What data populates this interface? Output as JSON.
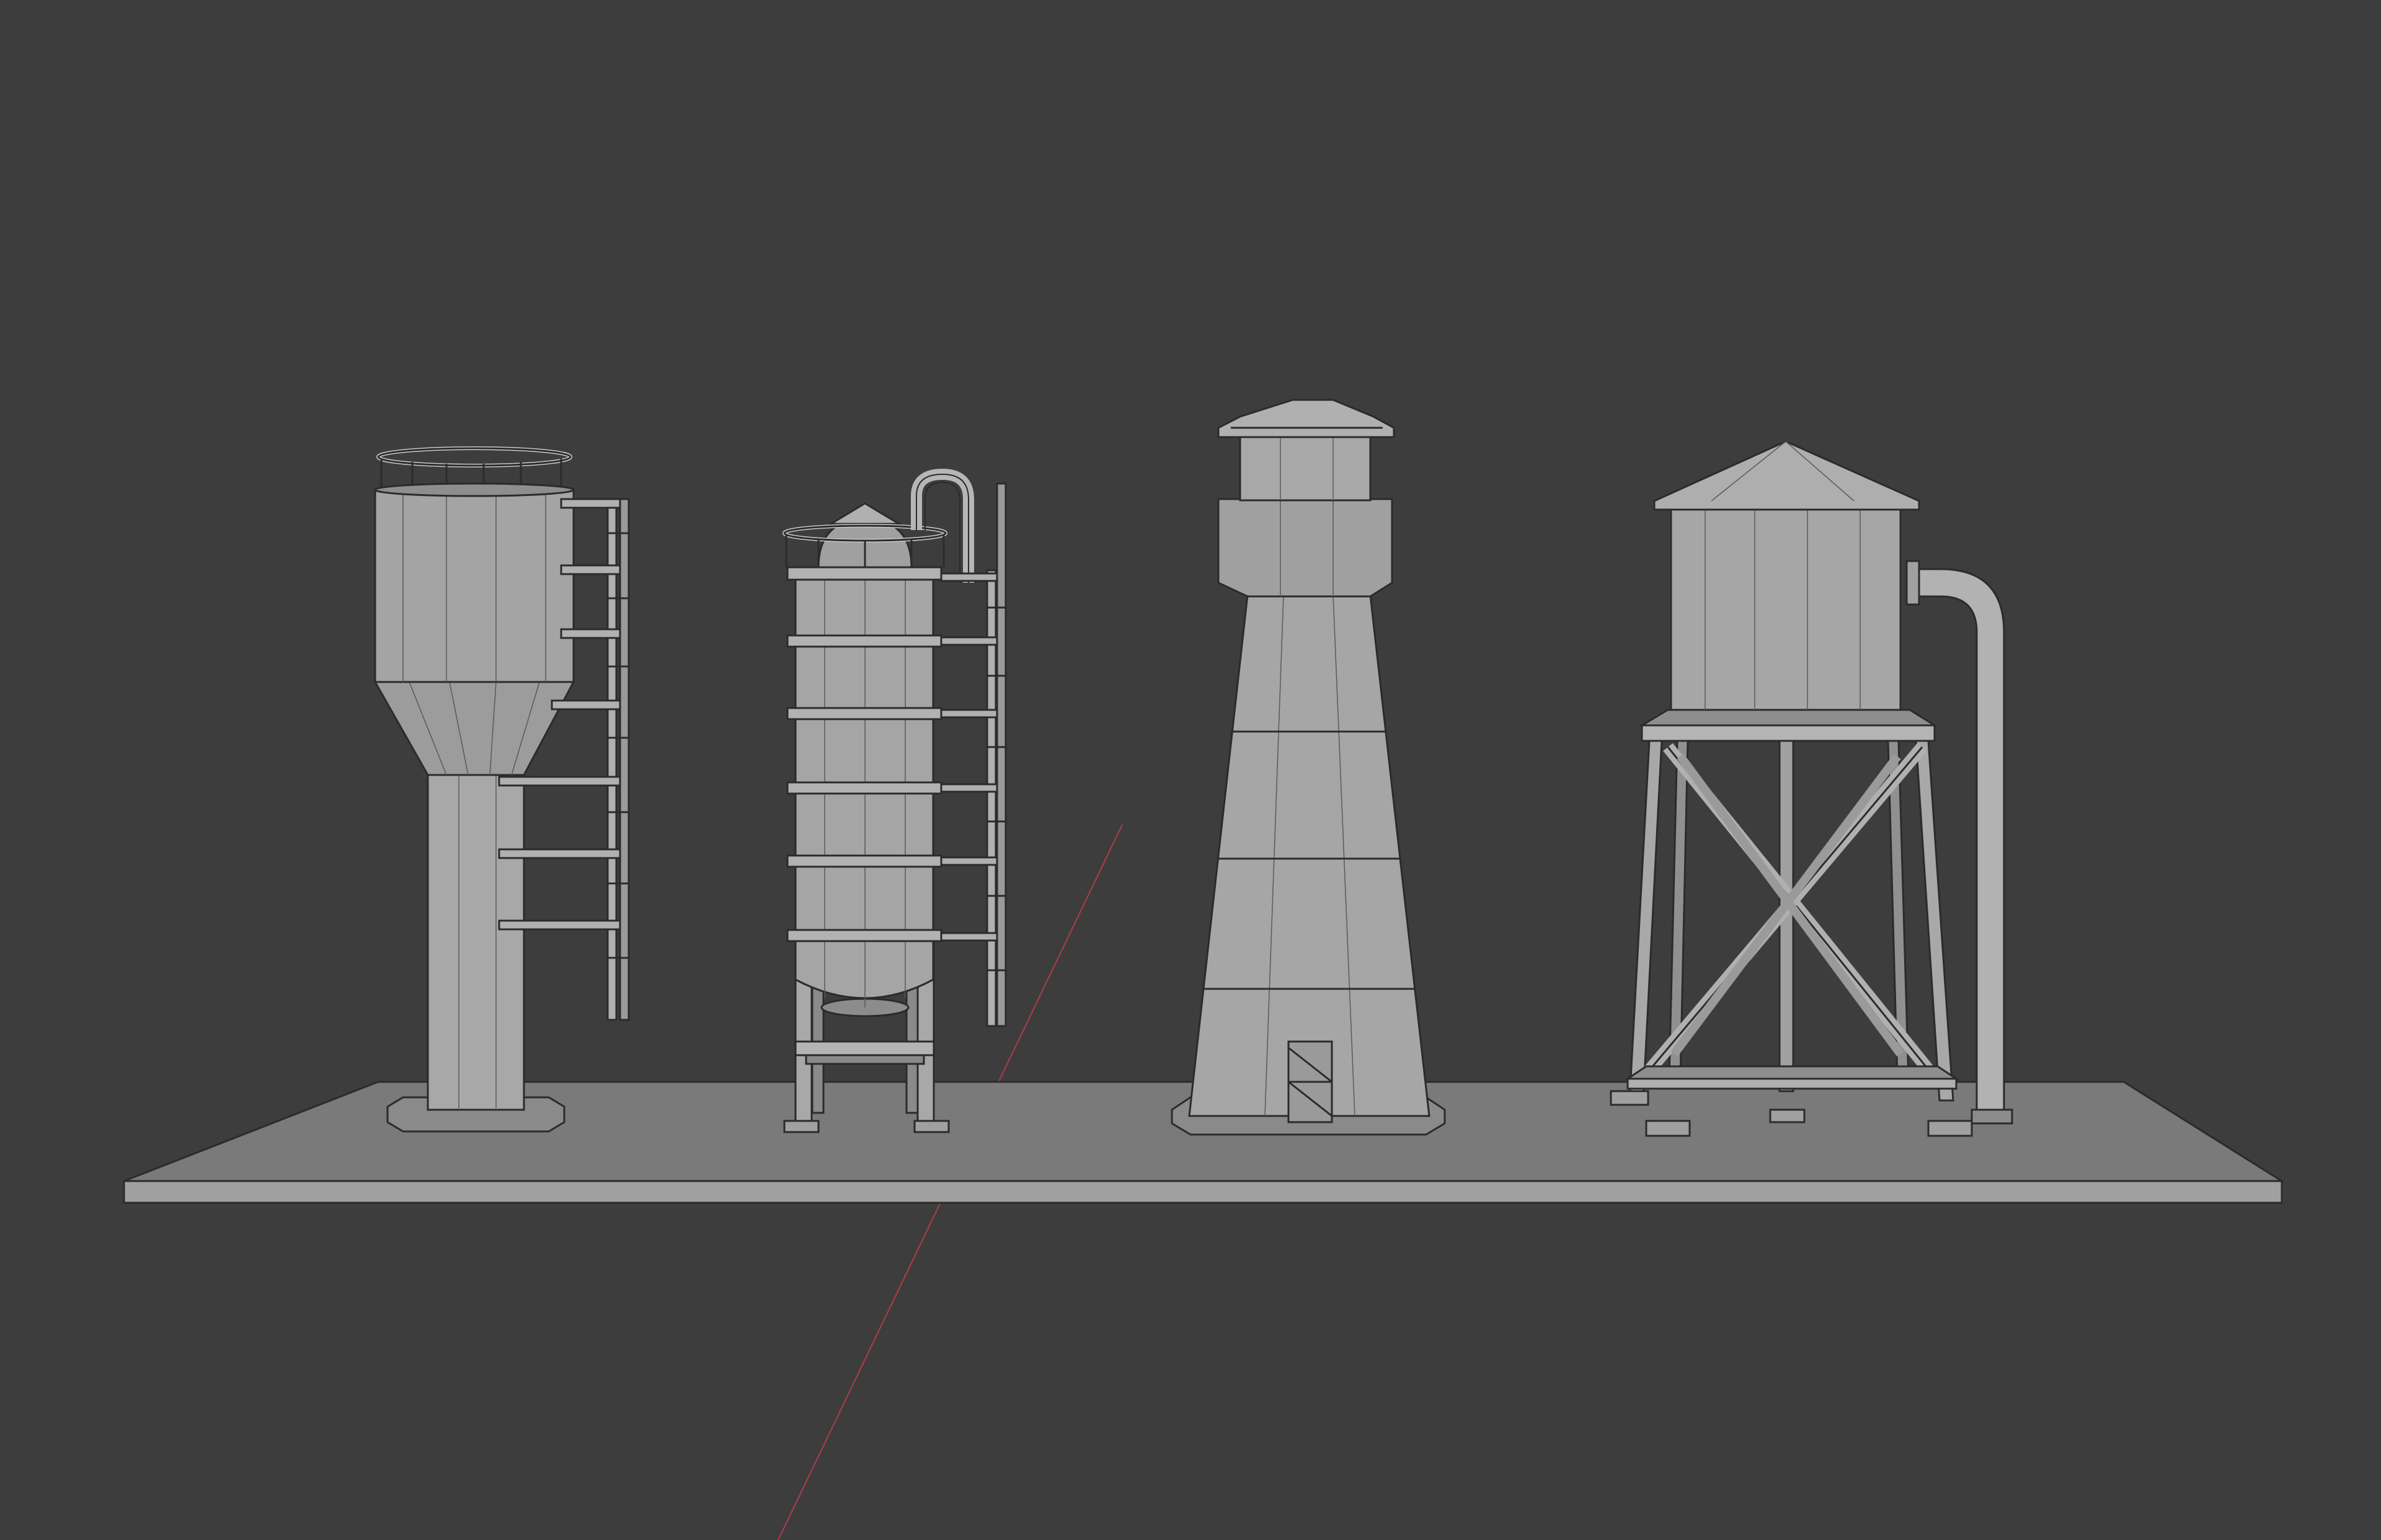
{
  "viewport": {
    "background_color": "#3d3d3d",
    "model_base_color": "#9d9d9d",
    "model_light_color": "#b4b4b4",
    "model_shadow_color": "#808080",
    "edge_color": "#2b2b2b",
    "x_axis_line_color": "#b03c46"
  },
  "objects": [
    {
      "name": "concrete-water-tower-with-ladder"
    },
    {
      "name": "cylindrical-silo-with-ladder"
    },
    {
      "name": "lighthouse-style-tower-with-door"
    },
    {
      "name": "wooden-water-tank-on-frame-with-pipe"
    },
    {
      "name": "ground-plane"
    }
  ]
}
